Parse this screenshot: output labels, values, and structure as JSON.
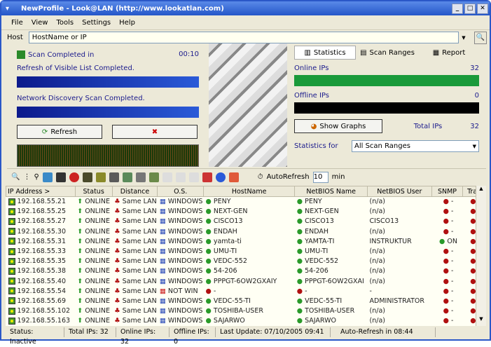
{
  "window": {
    "title": "NewProfile - Look@LAN (http://www.lookatlan.com)"
  },
  "menu": [
    "File",
    "View",
    "Tools",
    "Settings",
    "Help"
  ],
  "host": {
    "label": "Host",
    "placeholder": "HostName or IP"
  },
  "scan": {
    "completed_label": "Scan Completed in",
    "time": "00:10",
    "refresh_label": "Refresh of Visible List Completed.",
    "discovery_label": "Network Discovery Scan Completed.",
    "refresh_button": "Refresh"
  },
  "tabs": [
    "Statistics",
    "Scan Ranges",
    "Report"
  ],
  "stats": {
    "online_label": "Online IPs",
    "online": "32",
    "offline_label": "Offline IPs",
    "offline": "0",
    "show_graphs": "Show Graphs",
    "total_label": "Total IPs",
    "total": "32",
    "for_label": "Statistics for",
    "for_value": "All Scan Ranges"
  },
  "toolbar": {
    "autorefresh_label": "AutoRefresh",
    "autorefresh_value": "10",
    "min": "min"
  },
  "columns": [
    "IP Address >",
    "Status",
    "Distance",
    "O.S.",
    "HostName",
    "NetBIOS Name",
    "NetBIOS User",
    "SNMP",
    "Trap"
  ],
  "rows": [
    [
      "192.168.55.21",
      "ONLINE",
      "Same LAN",
      "WINDOWS",
      "PENY",
      "PENY",
      "(n/a)",
      "-",
      "-"
    ],
    [
      "192.168.55.25",
      "ONLINE",
      "Same LAN",
      "WINDOWS",
      "NEXT-GEN",
      "NEXT-GEN",
      "(n/a)",
      "-",
      "-"
    ],
    [
      "192.168.55.27",
      "ONLINE",
      "Same LAN",
      "WINDOWS",
      "CISCO13",
      "CISCO13",
      "CISCO13",
      "-",
      "-"
    ],
    [
      "192.168.55.30",
      "ONLINE",
      "Same LAN",
      "WINDOWS",
      "ENDAH",
      "ENDAH",
      "(n/a)",
      "-",
      "-"
    ],
    [
      "192.168.55.31",
      "ONLINE",
      "Same LAN",
      "WINDOWS",
      "yamta-ti",
      "YAMTA-TI",
      "INSTRUKTUR",
      "ON",
      "-"
    ],
    [
      "192.168.55.33",
      "ONLINE",
      "Same LAN",
      "WINDOWS",
      "UMU-TI",
      "UMU-TI",
      "(n/a)",
      "-",
      "-"
    ],
    [
      "192.168.55.35",
      "ONLINE",
      "Same LAN",
      "WINDOWS",
      "VEDC-552",
      "VEDC-552",
      "(n/a)",
      "-",
      "-"
    ],
    [
      "192.168.55.38",
      "ONLINE",
      "Same LAN",
      "WINDOWS",
      "54-206",
      "54-206",
      "(n/a)",
      "-",
      "-"
    ],
    [
      "192.168.55.40",
      "ONLINE",
      "Same LAN",
      "WINDOWS",
      "PPPGT-6OW2GXAIY",
      "PPPGT-6OW2GXAI",
      "(n/a)",
      "-",
      "-"
    ],
    [
      "192.168.55.54",
      "ONLINE",
      "Same LAN",
      "NOT WIN",
      "-",
      "-",
      "-",
      "-",
      "-"
    ],
    [
      "192.168.55.69",
      "ONLINE",
      "Same LAN",
      "WINDOWS",
      "VEDC-55-TI",
      "VEDC-55-TI",
      "ADMINISTRATOR",
      "-",
      "-"
    ],
    [
      "192.168.55.102",
      "ONLINE",
      "Same LAN",
      "WINDOWS",
      "TOSHIBA-USER",
      "TOSHIBA-USER",
      "(n/a)",
      "-",
      "-"
    ],
    [
      "192.168.55.163",
      "ONLINE",
      "Same LAN",
      "WINDOWS",
      "SAJARWO",
      "SAJARWO",
      "(n/a)",
      "-",
      "-"
    ]
  ],
  "status": [
    "Status: Inactive",
    "Total IPs: 32",
    "Online IPs: 32",
    "Offline IPs: 0",
    "Last Update: 07/10/2005 09:41",
    "Auto-Refresh in 08:44"
  ]
}
